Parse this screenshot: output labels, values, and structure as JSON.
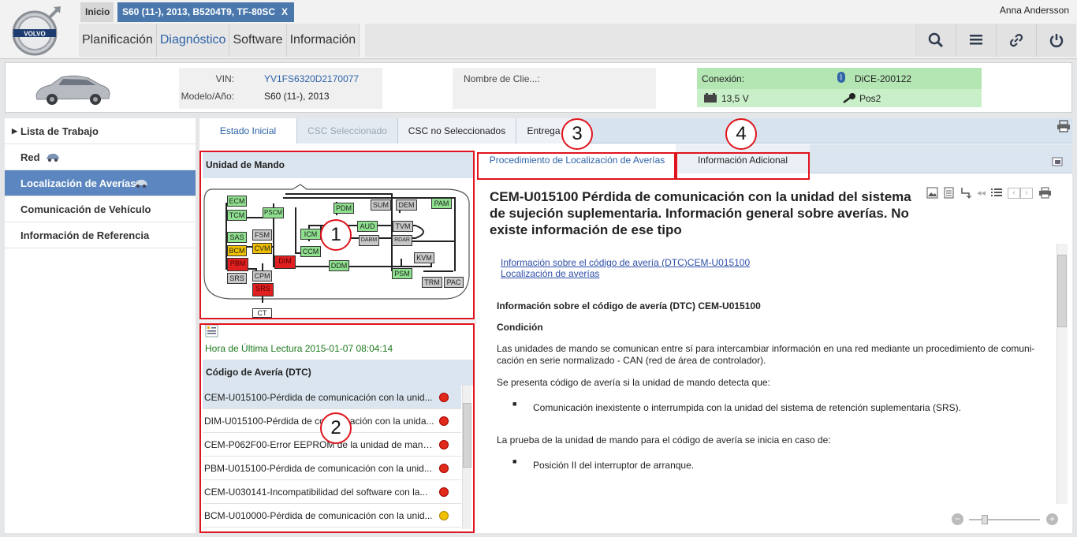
{
  "header": {
    "tabs": {
      "home": "Inicio",
      "vehicle": "S60 (11-), 2013, B5204T9, TF-80SC",
      "vehicle_close": "X"
    },
    "user": "Anna Andersson",
    "nav": [
      "Planificación",
      "Diagnóstico",
      "Software",
      "Información"
    ],
    "toolbar_icons": [
      "search-icon",
      "list-icon",
      "link-icon",
      "power-icon"
    ],
    "brand": "VOLVO"
  },
  "vehicle_info": {
    "vin_label": "VIN:",
    "vin": "YV1FS6320D2170077",
    "model_label": "Modelo/Año:",
    "model": "S60 (11-), 2013",
    "customer_label": "Nombre de Clie...:",
    "connection_label": "Conexión:",
    "connection": "DiCE-200122",
    "voltage": "13,5 V",
    "ignition": "Pos2"
  },
  "sidebar": {
    "items": [
      {
        "label": "Lista de Trabajo"
      },
      {
        "label": "Red"
      },
      {
        "label": "Localización de Averías"
      },
      {
        "label": "Comunicación de Vehículo"
      },
      {
        "label": "Información de Referencia"
      }
    ]
  },
  "main_tabs": [
    "Estado Inicial",
    "CSC Seleccionado",
    "CSC no Seleccionados",
    "Entrega"
  ],
  "callouts": [
    "1",
    "2",
    "3",
    "4"
  ],
  "control_units": {
    "title": "Unidad de Mando",
    "modules": [
      "ECM",
      "TCM",
      "PSCM",
      "PDM",
      "SUM",
      "DEM",
      "PAM",
      "SAS",
      "FSM",
      "BCM",
      "CVM",
      "PBM",
      "DIM",
      "SRS",
      "CPM",
      "SRS",
      "CT",
      "ICM",
      "AUD",
      "TVM",
      "DABM",
      "RDAR",
      "CCM",
      "DDM",
      "KVM",
      "PSM",
      "TRM",
      "PAC"
    ]
  },
  "reading": {
    "last_read_label": "Hora de Última Lectura",
    "last_read_time": "2015-01-07 08:04:14"
  },
  "dtc": {
    "title": "Código de Avería (DTC)",
    "rows": [
      {
        "text": "CEM-U015100-Pérdida de comunicación con la unid...",
        "status": "#e02a1a"
      },
      {
        "text": "DIM-U015100-Pérdida de comunicación con la unida...",
        "status": "#e02a1a"
      },
      {
        "text": "CEM-P062F00-Error EEPROM de la unidad de mand...",
        "status": "#e02a1a"
      },
      {
        "text": "PBM-U015100-Pérdida de comunicación con la unid...",
        "status": "#e02a1a"
      },
      {
        "text": "CEM-U030141-Incompatibilidad del software con la...",
        "status": "#e02a1a"
      },
      {
        "text": "BCM-U010000-Pérdida de comunicación con la unid...",
        "status": "#f0c000"
      }
    ]
  },
  "doc_tabs": [
    "Procedimiento de Localización de Averías",
    "Información Adicional"
  ],
  "document": {
    "title": "CEM-U015100 Pérdida de comunicación con la unidad del sistema de sujeción suplementaria. Información general sobre averías. No existe información de ese tipo",
    "links": [
      "Información sobre el código de avería (DTC)CEM-U015100",
      "Localización de averías"
    ],
    "heading": "Información sobre el código de avería (DTC) CEM-U015100",
    "condition": "Condición",
    "p1": "Las unidades de mando se comunican entre sí para intercambiar información en una red mediante un procedimiento de comuni-cación en serie normalizado - CAN (red de área de controlador).",
    "p2": "Se presenta código de avería si la unidad de mando detecta que:",
    "bullet1": "Comunicación inexistente o interrumpida con la unidad del sistema de retención suplementaria (SRS).",
    "p3": "La prueba de la unidad de mando para el código de avería se inicia en caso de:",
    "bullet2": "Posición II del interruptor de arranque."
  }
}
